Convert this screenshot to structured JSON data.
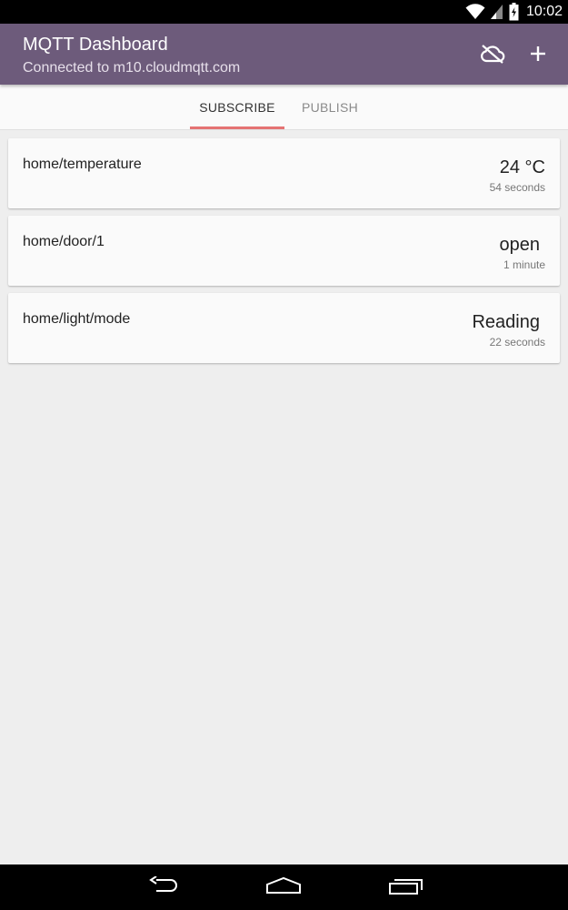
{
  "status_bar": {
    "time": "10:02",
    "icons": [
      "wifi-icon",
      "signal-icon",
      "battery-icon"
    ]
  },
  "app_bar": {
    "title": "MQTT Dashboard",
    "subtitle": "Connected to m10.cloudmqtt.com",
    "actions": [
      "cloud-off-icon",
      "add-icon"
    ],
    "background": "#6d5b7b"
  },
  "tabs": [
    {
      "label": "SUBSCRIBE",
      "selected": true
    },
    {
      "label": "PUBLISH",
      "selected": false
    }
  ],
  "accent_color": "#e57373",
  "subscriptions": [
    {
      "topic": "home/temperature",
      "value": "24 °C",
      "time": "54 seconds"
    },
    {
      "topic": "home/door/1",
      "value": "open",
      "time": "1 minute"
    },
    {
      "topic": "home/light/mode",
      "value": "Reading",
      "time": "22 seconds"
    }
  ],
  "nav_bar": {
    "buttons": [
      "back-icon",
      "home-icon",
      "recents-icon"
    ]
  }
}
